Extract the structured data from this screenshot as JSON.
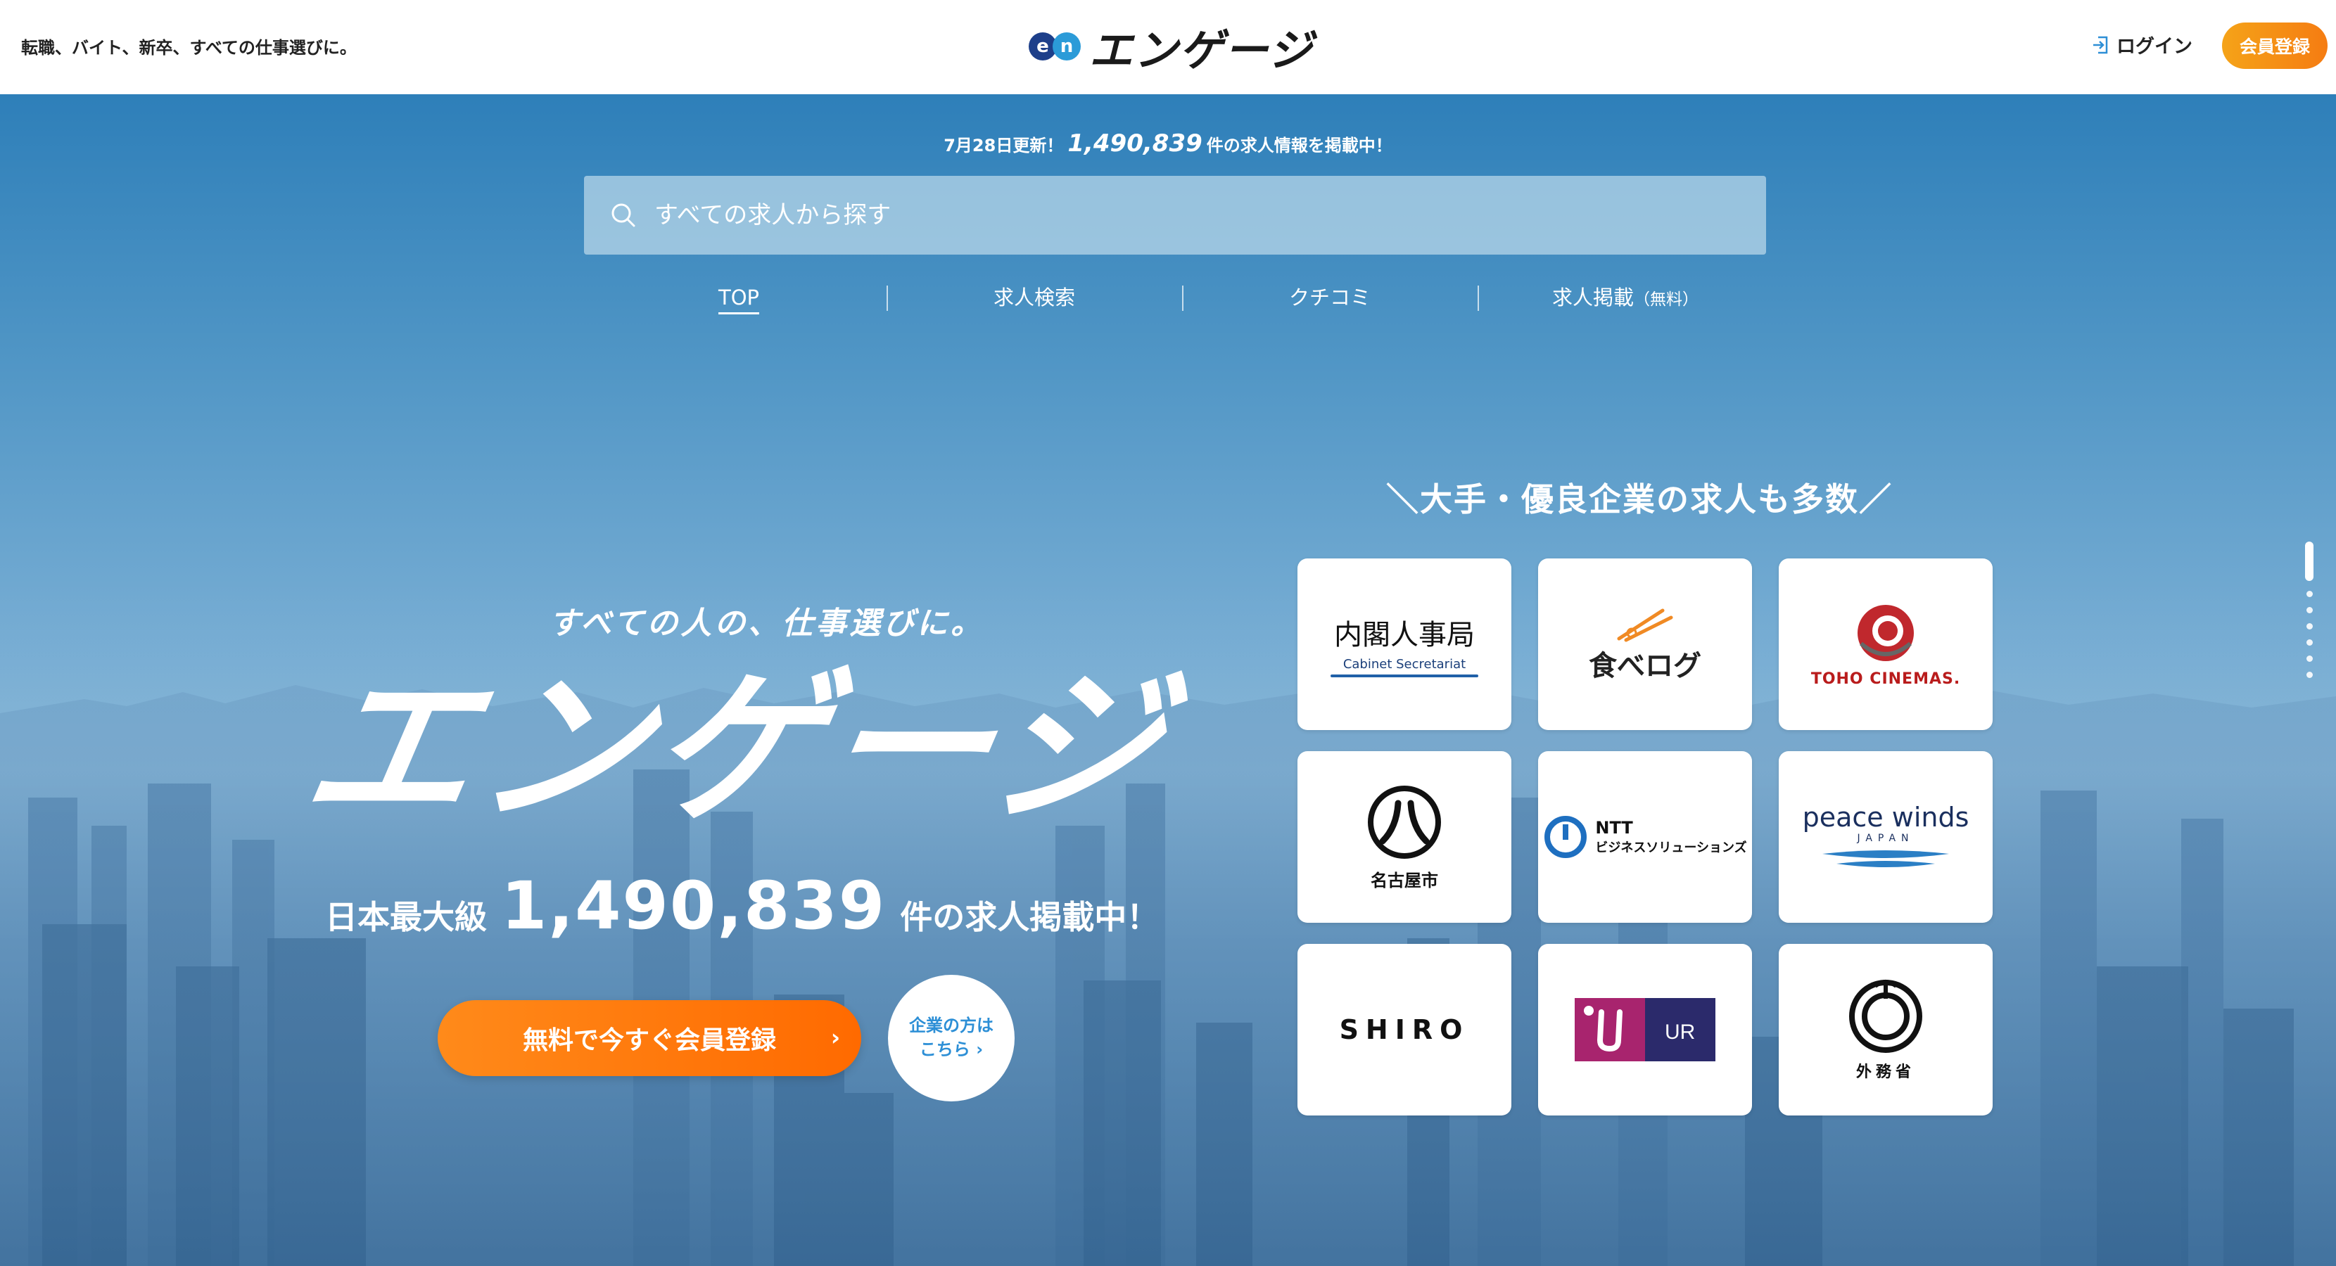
{
  "header": {
    "tagline": "転職、バイト、新卒、すべての仕事選びに。",
    "logo_text": "エンゲージ",
    "logo_badge": [
      "e",
      "n"
    ],
    "login_label": "ログイン",
    "register_label": "会員登録"
  },
  "hero": {
    "update_prefix": "7月28日更新！",
    "update_count": "1,490,839",
    "update_suffix": "件の求人情報を掲載中！",
    "search_placeholder": "すべての求人から探す",
    "nav": [
      {
        "label": "TOP",
        "active": true
      },
      {
        "label": "求人検索"
      },
      {
        "label": "クチコミ"
      },
      {
        "label": "求人掲載",
        "sub": "（無料）"
      }
    ],
    "catch": "すべての人の、仕事選びに。",
    "big_logo": "エンゲージ",
    "count_prefix": "日本最大級",
    "count": "1,490,839",
    "count_suffix": "件の求人掲載中！",
    "cta_label": "無料で今すぐ会員登録",
    "corp_line1": "企業の方は",
    "corp_line2": "こちら",
    "companies_title": "＼大手・優良企業の求人も多数／"
  },
  "companies": {
    "cabinet": {
      "name": "内閣人事局",
      "sub": "Cabinet Secretariat"
    },
    "tabelog": {
      "name": "食べログ"
    },
    "toho": {
      "name": "TOHO CINEMAS."
    },
    "nagoya": {
      "name": "名古屋市"
    },
    "ntt": {
      "name": "NTT",
      "sub": "ビジネスソリューションズ"
    },
    "peace": {
      "name": "peace winds",
      "sub": "JAPAN"
    },
    "shiro": {
      "name": "SHIRO"
    },
    "ur": {
      "name": "UR"
    },
    "gaimu": {
      "name": "外務省"
    }
  },
  "colors": {
    "accent_orange": "#f57c12",
    "brand_blue": "#1d3f8a",
    "link_blue": "#2d8fd6"
  }
}
